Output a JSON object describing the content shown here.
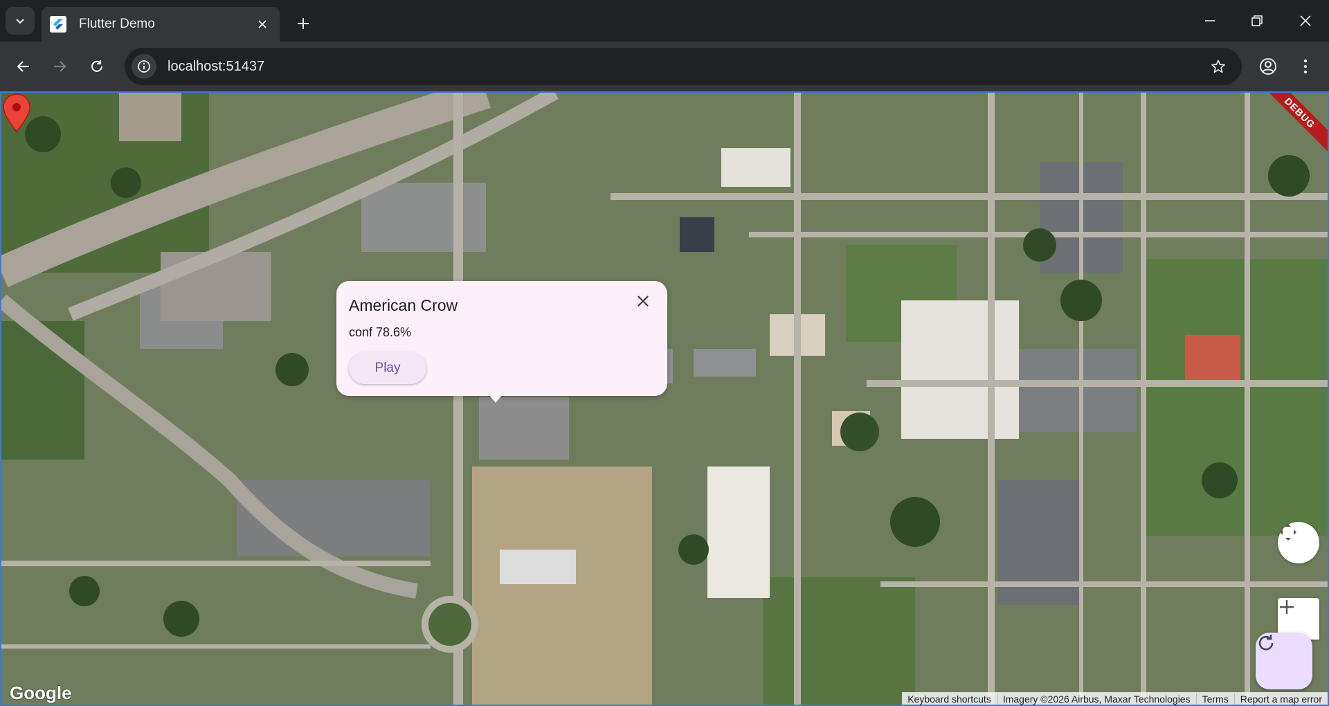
{
  "browser": {
    "tab_title": "Flutter Demo",
    "url": "localhost:51437"
  },
  "debug_banner": "DEBUG",
  "info_window": {
    "title": "American Crow",
    "subtitle": "conf 78.6%",
    "play_label": "Play"
  },
  "map": {
    "logo": "Google",
    "attribution": {
      "keyboard": "Keyboard shortcuts",
      "imagery": "Imagery ©2026 Airbus, Maxar Technologies",
      "terms": "Terms",
      "report": "Report a map error"
    }
  },
  "icons": {
    "tab_search": "chevron-down-icon",
    "favicon": "flutter-icon",
    "tab_close": "close-icon",
    "new_tab": "plus-icon",
    "minimize": "minimize-icon",
    "restore": "restore-icon",
    "close_window": "close-icon",
    "back": "arrow-left-icon",
    "forward": "arrow-right-icon",
    "reload": "reload-icon",
    "site_info": "info-icon",
    "bookmark": "star-icon",
    "profile": "account-icon",
    "menu": "kebab-menu-icon",
    "marker": "map-pin-icon",
    "fullscreen": "fullscreen-icon",
    "zoom_in": "plus-icon",
    "refresh": "refresh-icon"
  },
  "colors": {
    "marker": "#ea4335",
    "fab_bg": "#eaddff",
    "info_bg": "#fcf1fb",
    "play_text": "#6750a4",
    "debug": "#b71c1c"
  }
}
